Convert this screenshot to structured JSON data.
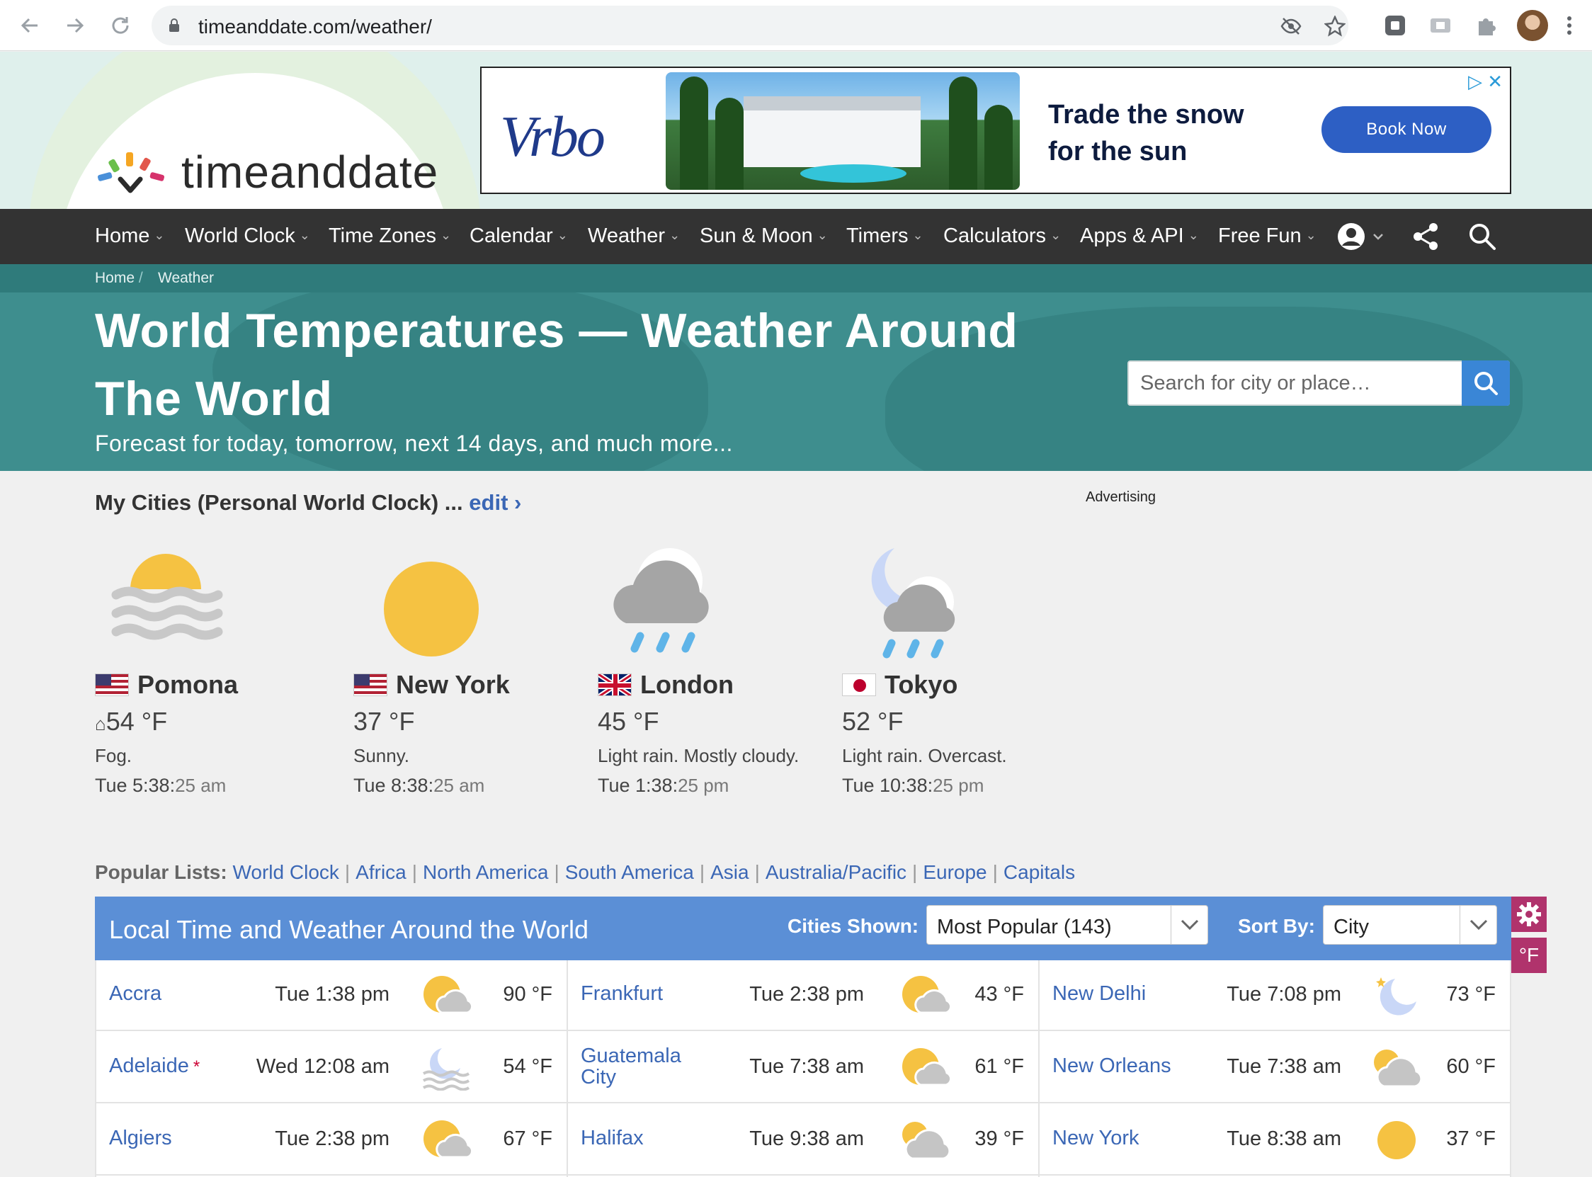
{
  "browser": {
    "url": "timeanddate.com/weather/"
  },
  "site": {
    "logo_text": "timeanddate"
  },
  "ad": {
    "brand": "Vrbo",
    "tagline_1": "Trade the snow",
    "tagline_2": "for the sun",
    "cta": "Book Now"
  },
  "nav": {
    "items": [
      "Home",
      "World Clock",
      "Time Zones",
      "Calendar",
      "Weather",
      "Sun & Moon",
      "Timers",
      "Calculators",
      "Apps & API",
      "Free Fun"
    ]
  },
  "breadcrumb": [
    "Home",
    "Weather"
  ],
  "hero": {
    "title": "World Temperatures — Weather Around The World",
    "subtitle": "Forecast for today, tomorrow, next 14 days, and much more...",
    "search_placeholder": "Search for city or place…"
  },
  "my_cities": {
    "title": "My Cities (Personal World Clock) ...",
    "edit": "edit ›",
    "advertising": "Advertising",
    "cities": [
      {
        "name": "Pomona",
        "temp": "54 °F",
        "desc": "Fog.",
        "time": "Tue 5:38:",
        "sec": "25 am",
        "icon": "fog-sun-icon",
        "flag": "us"
      },
      {
        "name": "New York",
        "temp": "37 °F",
        "desc": "Sunny.",
        "time": "Tue 8:38:",
        "sec": "25 am",
        "icon": "sun-icon",
        "flag": "us"
      },
      {
        "name": "London",
        "temp": "45 °F",
        "desc": "Light rain. Mostly cloudy.",
        "time": "Tue 1:38:",
        "sec": "25 pm",
        "icon": "rain-cloud-icon",
        "flag": "uk"
      },
      {
        "name": "Tokyo",
        "temp": "52 °F",
        "desc": "Light rain. Overcast.",
        "time": "Tue 10:38:",
        "sec": "25 pm",
        "icon": "night-rain-icon",
        "flag": "jp"
      }
    ]
  },
  "popular": {
    "label": "Popular Lists:",
    "links": [
      "World Clock",
      "Africa",
      "North America",
      "South America",
      "Asia",
      "Australia/Pacific",
      "Europe",
      "Capitals"
    ]
  },
  "table": {
    "title": "Local Time and Weather Around the World",
    "cities_shown_label": "Cities Shown:",
    "cities_shown_value": "Most Popular (143)",
    "sort_by_label": "Sort By:",
    "sort_by_value": "City",
    "unit_button": "°F",
    "rows": [
      [
        {
          "city": "Accra",
          "time": "Tue 1:38 pm",
          "temp": "90 °F",
          "icon": "partly-cloudy-icon"
        },
        {
          "city": "Frankfurt",
          "time": "Tue 2:38 pm",
          "temp": "43 °F",
          "icon": "partly-cloudy-icon"
        },
        {
          "city": "New Delhi",
          "time": "Tue 7:08 pm",
          "temp": "73 °F",
          "icon": "moon-star-icon"
        }
      ],
      [
        {
          "city": "Adelaide",
          "star": "*",
          "time": "Wed 12:08 am",
          "temp": "54 °F",
          "icon": "moon-fog-icon"
        },
        {
          "city": "Guatemala City",
          "time": "Tue 7:38 am",
          "temp": "61 °F",
          "icon": "partly-cloudy-icon"
        },
        {
          "city": "New Orleans",
          "time": "Tue 7:38 am",
          "temp": "60 °F",
          "icon": "mostly-cloudy-icon"
        }
      ],
      [
        {
          "city": "Algiers",
          "time": "Tue 2:38 pm",
          "temp": "67 °F",
          "icon": "partly-cloudy-icon"
        },
        {
          "city": "Halifax",
          "time": "Tue 9:38 am",
          "temp": "39 °F",
          "icon": "mostly-cloudy-icon"
        },
        {
          "city": "New York",
          "time": "Tue 8:38 am",
          "temp": "37 °F",
          "icon": "sun-icon"
        }
      ]
    ]
  }
}
